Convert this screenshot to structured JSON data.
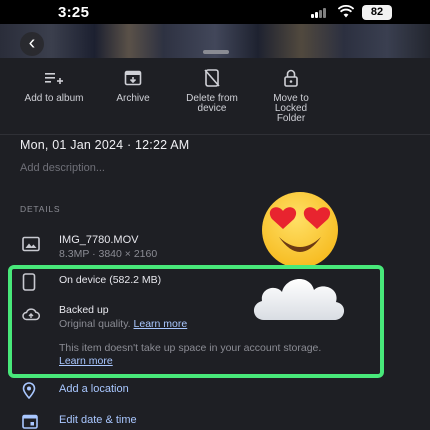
{
  "status_bar": {
    "time": "3:25",
    "battery": "82"
  },
  "actions": [
    {
      "label": "Add to album",
      "icon": "add-to-album-icon"
    },
    {
      "label": "Archive",
      "icon": "archive-icon"
    },
    {
      "label": "Delete from device",
      "icon": "delete-from-device-icon"
    },
    {
      "label": "Move to Locked Folder",
      "icon": "locked-folder-icon"
    }
  ],
  "info": {
    "date": "Mon, 01 Jan 2024  ·  12:22 AM",
    "description_placeholder": "Add description...",
    "details_heading": "DETAILS"
  },
  "file": {
    "name": "IMG_7780.MOV",
    "meta": "8.3MP  ·  3840 × 2160"
  },
  "storage": {
    "on_device": "On device (582.2 MB)",
    "backed_up": "Backed up",
    "quality": "Original quality.",
    "learn_more": "Learn more",
    "space_note": "This item doesn't take up space in your account storage.",
    "learn_more_2": "Learn more"
  },
  "more": {
    "location": "Add a location",
    "edit_date": "Edit date & time"
  },
  "colors": {
    "highlight": "#48e87a",
    "link": "#a9c7ff",
    "background": "#1e1f24"
  }
}
